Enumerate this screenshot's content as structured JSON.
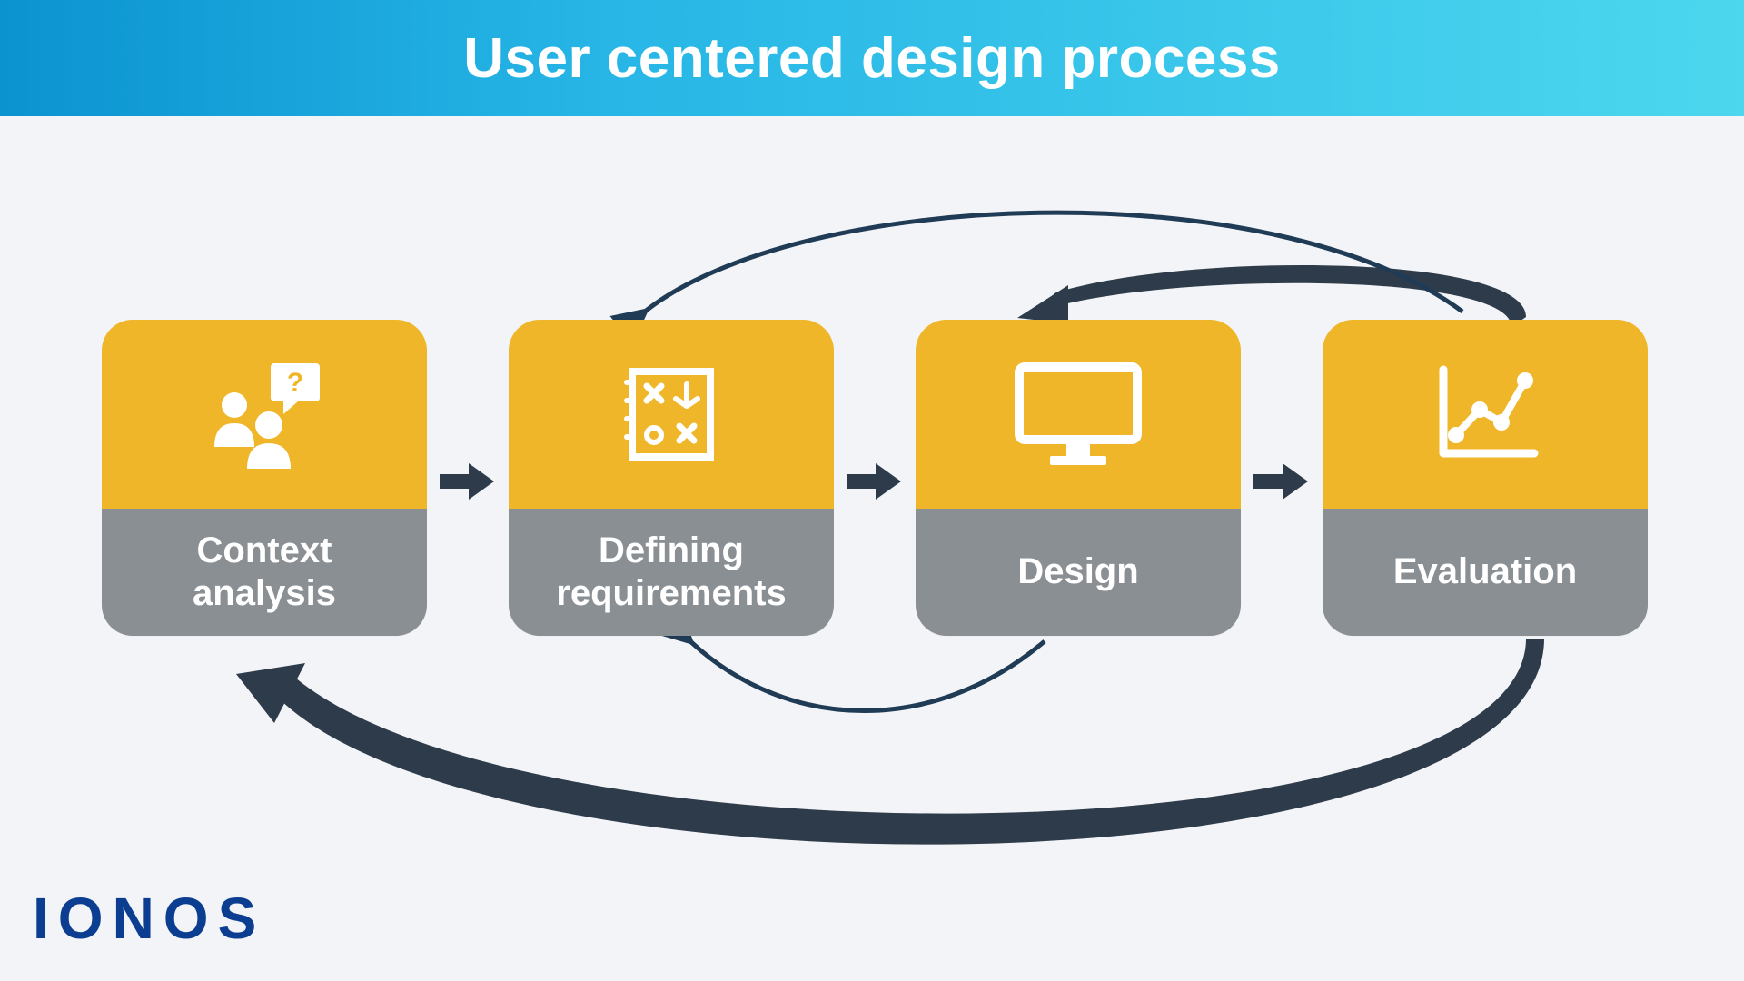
{
  "header": {
    "title": "User centered design process"
  },
  "steps": [
    {
      "id": "context-analysis",
      "label": "Context\nanalysis",
      "icon": "people-question-icon"
    },
    {
      "id": "defining-requirements",
      "label": "Defining\nrequirements",
      "icon": "strategy-board-icon"
    },
    {
      "id": "design",
      "label": "Design",
      "icon": "monitor-icon"
    },
    {
      "id": "evaluation",
      "label": "Evaluation",
      "icon": "chart-line-icon"
    }
  ],
  "flow": {
    "forward": [
      {
        "from": "context-analysis",
        "to": "defining-requirements"
      },
      {
        "from": "defining-requirements",
        "to": "design"
      },
      {
        "from": "design",
        "to": "evaluation"
      }
    ],
    "feedback": [
      {
        "from": "evaluation",
        "to": "design",
        "position": "top"
      },
      {
        "from": "evaluation",
        "to": "defining-requirements",
        "position": "top"
      },
      {
        "from": "design",
        "to": "defining-requirements",
        "position": "bottom"
      },
      {
        "from": "evaluation",
        "to": "context-analysis",
        "position": "bottom"
      }
    ]
  },
  "brand": {
    "logo_text": "IONOS"
  },
  "colors": {
    "header_gradient_start": "#0b93d0",
    "header_gradient_end": "#4cd7ee",
    "card_top": "#f0b629",
    "card_bottom": "#8a8f94",
    "arrow_dark": "#2e3b4a",
    "arrow_light": "#1f3c57",
    "logo": "#0b3d91",
    "background": "#f3f4f7"
  }
}
